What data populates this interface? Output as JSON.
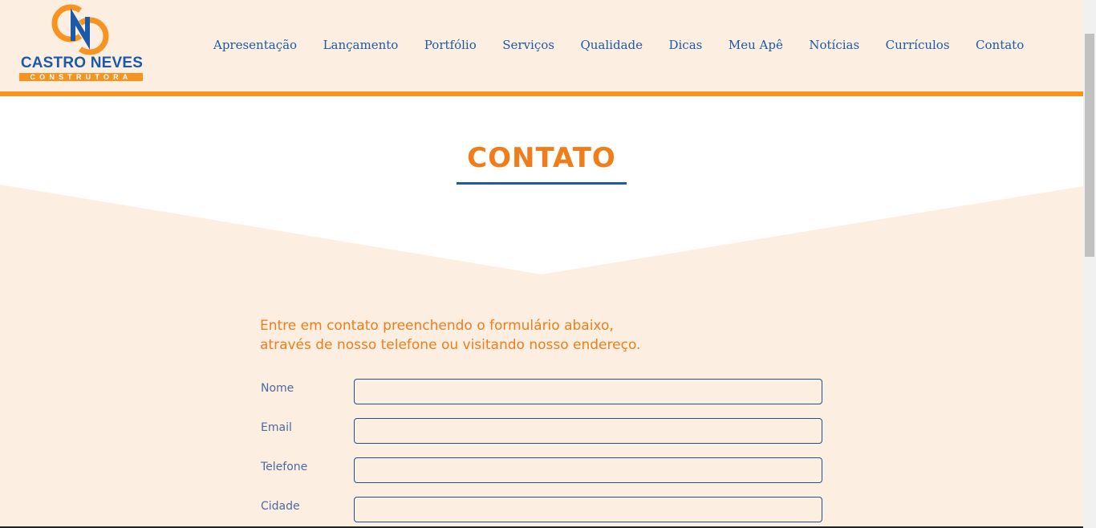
{
  "header": {
    "logo": {
      "mark": "CN",
      "name": "CASTRO NEVES",
      "tagline": "CONSTRUTORA"
    },
    "nav": [
      {
        "label": "Apresentação",
        "name": "nav-apresentacao"
      },
      {
        "label": "Lançamento",
        "name": "nav-lancamento"
      },
      {
        "label": "Portfólio",
        "name": "nav-portfolio"
      },
      {
        "label": "Serviços",
        "name": "nav-servicos"
      },
      {
        "label": "Qualidade",
        "name": "nav-qualidade"
      },
      {
        "label": "Dicas",
        "name": "nav-dicas"
      },
      {
        "label": "Meu Apê",
        "name": "nav-meu-ape"
      },
      {
        "label": "Notícias",
        "name": "nav-noticias"
      },
      {
        "label": "Currículos",
        "name": "nav-curriculos"
      },
      {
        "label": "Contato",
        "name": "nav-contato"
      }
    ]
  },
  "section": {
    "title": "CONTATO",
    "intro_line1": "Entre em contato preenchendo o formulário abaixo,",
    "intro_line2": "através de nosso telefone ou visitando nosso endereço."
  },
  "form": {
    "fields": [
      {
        "label": "Nome",
        "value": "",
        "name": "nome"
      },
      {
        "label": "Email",
        "value": "",
        "name": "email"
      },
      {
        "label": "Telefone",
        "value": "",
        "name": "telefone"
      },
      {
        "label": "Cidade",
        "value": "",
        "name": "cidade"
      }
    ]
  },
  "colors": {
    "accent_orange": "#f07d1a",
    "header_bar": "#f7931e",
    "brand_blue": "#1a5aa8",
    "page_bg": "#fdeee2"
  }
}
